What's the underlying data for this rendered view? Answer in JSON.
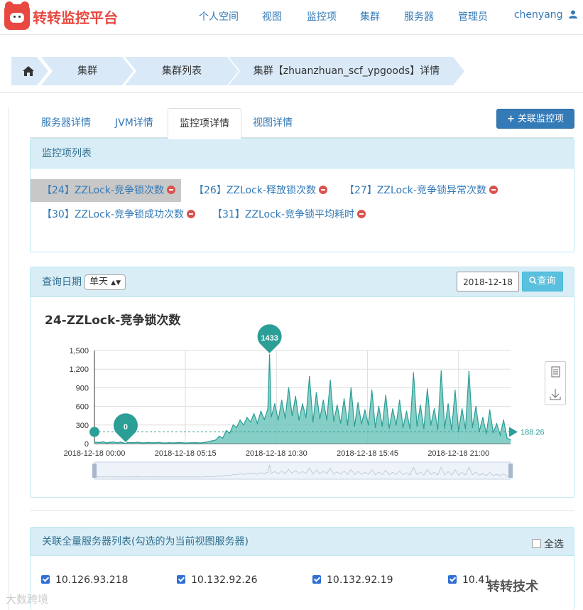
{
  "brand": {
    "title": "转转监控平台"
  },
  "nav": {
    "items": [
      "个人空间",
      "视图",
      "监控项",
      "集群",
      "服务器",
      "管理员"
    ],
    "user": "chenyang"
  },
  "breadcrumb": [
    "集群",
    "集群列表",
    "集群【zhuanzhuan_scf_ypgoods】详情"
  ],
  "tabs": [
    "服务器详情",
    "JVM详情",
    "监控项详情",
    "视图详情"
  ],
  "actions": {
    "add_monitor": "关联监控项"
  },
  "monitor_panel": {
    "title": "监控项列表",
    "items": [
      "【24】ZZLock-竞争锁次数",
      "【26】ZZLock-释放锁次数",
      "【27】ZZLock-竞争锁异常次数",
      "【30】ZZLock-竞争锁成功次数",
      "【31】ZZLock-竞争锁平均耗时"
    ]
  },
  "query": {
    "label": "查询日期",
    "mode": "单天",
    "date": "2018-12-18",
    "search": "查询"
  },
  "chart_data": {
    "type": "area",
    "title": "24-ZZLock-竞争锁次数",
    "x_ticks": [
      "2018-12-18 00:00",
      "2018-12-18 05:15",
      "2018-12-18 10:30",
      "2018-12-18 15:45",
      "2018-12-18 21:00"
    ],
    "y_ticks": [
      "0",
      "300",
      "600",
      "900",
      "1,200",
      "1,500"
    ],
    "ylim": [
      0,
      1500
    ],
    "x_range_hours": [
      0,
      24
    ],
    "max_label": "1433",
    "min_label": "0",
    "avg_label": "188.26",
    "series": [
      {
        "values": [
          {
            "x": 0.0,
            "y": 25
          },
          {
            "x": 0.3,
            "y": 18
          },
          {
            "x": 0.5,
            "y": 30
          },
          {
            "x": 0.7,
            "y": 12
          },
          {
            "x": 0.9,
            "y": 22
          },
          {
            "x": 1.1,
            "y": 28
          },
          {
            "x": 1.3,
            "y": 15
          },
          {
            "x": 1.5,
            "y": 24
          },
          {
            "x": 1.7,
            "y": 10
          },
          {
            "x": 1.8,
            "y": 0
          },
          {
            "x": 1.9,
            "y": 20
          },
          {
            "x": 2.2,
            "y": 16
          },
          {
            "x": 2.5,
            "y": 22
          },
          {
            "x": 2.8,
            "y": 12
          },
          {
            "x": 3.1,
            "y": 18
          },
          {
            "x": 3.4,
            "y": 14
          },
          {
            "x": 3.7,
            "y": 20
          },
          {
            "x": 4.0,
            "y": 10
          },
          {
            "x": 4.3,
            "y": 15
          },
          {
            "x": 4.6,
            "y": 12
          },
          {
            "x": 4.9,
            "y": 18
          },
          {
            "x": 5.2,
            "y": 10
          },
          {
            "x": 5.5,
            "y": 14
          },
          {
            "x": 5.8,
            "y": 16
          },
          {
            "x": 6.1,
            "y": 12
          },
          {
            "x": 6.4,
            "y": 22
          },
          {
            "x": 6.7,
            "y": 40
          },
          {
            "x": 7.0,
            "y": 60
          },
          {
            "x": 7.2,
            "y": 120
          },
          {
            "x": 7.4,
            "y": 90
          },
          {
            "x": 7.6,
            "y": 210
          },
          {
            "x": 7.8,
            "y": 170
          },
          {
            "x": 8.0,
            "y": 300
          },
          {
            "x": 8.2,
            "y": 260
          },
          {
            "x": 8.4,
            "y": 380
          },
          {
            "x": 8.6,
            "y": 300
          },
          {
            "x": 8.8,
            "y": 420
          },
          {
            "x": 9.0,
            "y": 350
          },
          {
            "x": 9.2,
            "y": 480
          },
          {
            "x": 9.4,
            "y": 330
          },
          {
            "x": 9.6,
            "y": 520
          },
          {
            "x": 9.8,
            "y": 390
          },
          {
            "x": 10.0,
            "y": 560
          },
          {
            "x": 10.1,
            "y": 1433
          },
          {
            "x": 10.2,
            "y": 430
          },
          {
            "x": 10.4,
            "y": 640
          },
          {
            "x": 10.6,
            "y": 380
          },
          {
            "x": 10.8,
            "y": 700
          },
          {
            "x": 11.0,
            "y": 410
          },
          {
            "x": 11.2,
            "y": 900
          },
          {
            "x": 11.4,
            "y": 450
          },
          {
            "x": 11.6,
            "y": 760
          },
          {
            "x": 11.8,
            "y": 380
          },
          {
            "x": 12.0,
            "y": 640
          },
          {
            "x": 12.2,
            "y": 420
          },
          {
            "x": 12.4,
            "y": 1080
          },
          {
            "x": 12.6,
            "y": 350
          },
          {
            "x": 12.8,
            "y": 820
          },
          {
            "x": 13.0,
            "y": 400
          },
          {
            "x": 13.2,
            "y": 700
          },
          {
            "x": 13.4,
            "y": 380
          },
          {
            "x": 13.6,
            "y": 1020
          },
          {
            "x": 13.8,
            "y": 360
          },
          {
            "x": 14.0,
            "y": 620
          },
          {
            "x": 14.2,
            "y": 330
          },
          {
            "x": 14.4,
            "y": 720
          },
          {
            "x": 14.6,
            "y": 300
          },
          {
            "x": 14.8,
            "y": 900
          },
          {
            "x": 15.0,
            "y": 280
          },
          {
            "x": 15.2,
            "y": 660
          },
          {
            "x": 15.4,
            "y": 320
          },
          {
            "x": 15.6,
            "y": 540
          },
          {
            "x": 15.8,
            "y": 300
          },
          {
            "x": 16.0,
            "y": 860
          },
          {
            "x": 16.2,
            "y": 260
          },
          {
            "x": 16.4,
            "y": 600
          },
          {
            "x": 16.6,
            "y": 280
          },
          {
            "x": 16.8,
            "y": 780
          },
          {
            "x": 17.0,
            "y": 250
          },
          {
            "x": 17.2,
            "y": 560
          },
          {
            "x": 17.4,
            "y": 300
          },
          {
            "x": 17.6,
            "y": 700
          },
          {
            "x": 17.8,
            "y": 260
          },
          {
            "x": 18.0,
            "y": 520
          },
          {
            "x": 18.2,
            "y": 240
          },
          {
            "x": 18.4,
            "y": 1140
          },
          {
            "x": 18.6,
            "y": 280
          },
          {
            "x": 18.8,
            "y": 620
          },
          {
            "x": 19.0,
            "y": 240
          },
          {
            "x": 19.2,
            "y": 880
          },
          {
            "x": 19.4,
            "y": 300
          },
          {
            "x": 19.6,
            "y": 560
          },
          {
            "x": 19.8,
            "y": 230
          },
          {
            "x": 20.0,
            "y": 1170
          },
          {
            "x": 20.2,
            "y": 250
          },
          {
            "x": 20.4,
            "y": 640
          },
          {
            "x": 20.6,
            "y": 220
          },
          {
            "x": 20.8,
            "y": 860
          },
          {
            "x": 21.0,
            "y": 200
          },
          {
            "x": 21.2,
            "y": 560
          },
          {
            "x": 21.4,
            "y": 240
          },
          {
            "x": 21.6,
            "y": 1160
          },
          {
            "x": 21.8,
            "y": 260
          },
          {
            "x": 22.0,
            "y": 600
          },
          {
            "x": 22.2,
            "y": 200
          },
          {
            "x": 22.4,
            "y": 420
          },
          {
            "x": 22.6,
            "y": 160
          },
          {
            "x": 22.8,
            "y": 540
          },
          {
            "x": 23.0,
            "y": 180
          },
          {
            "x": 23.2,
            "y": 320
          },
          {
            "x": 23.4,
            "y": 140
          },
          {
            "x": 23.6,
            "y": 380
          },
          {
            "x": 23.8,
            "y": 90
          },
          {
            "x": 24.0,
            "y": 60
          }
        ]
      }
    ],
    "color": "#2b9e96",
    "fill_color": "#5cbfb4"
  },
  "servers_panel": {
    "title": "关联全量服务器列表(勾选的为当前视图服务器)",
    "select_all": "全选",
    "servers": [
      "10.126.93.218",
      "10.132.92.26",
      "10.132.92.19",
      "10.41"
    ]
  },
  "watermark": {
    "left": "大数跨境",
    "right": "转转技术"
  }
}
